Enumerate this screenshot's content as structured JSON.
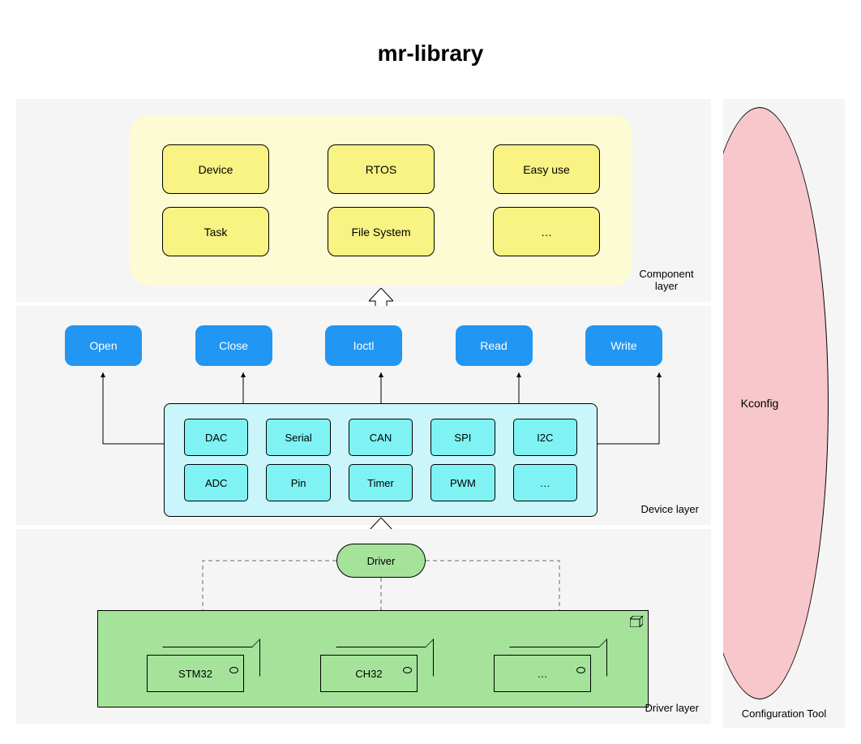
{
  "title": "mr-library",
  "layers": {
    "component": {
      "label": "Component layer",
      "items": [
        "Device",
        "RTOS",
        "Easy use",
        "Task",
        "File System",
        "…"
      ]
    },
    "device": {
      "label": "Device layer",
      "api": [
        "Open",
        "Close",
        "Ioctl",
        "Read",
        "Write"
      ],
      "items": [
        "DAC",
        "Serial",
        "CAN",
        "SPI",
        "I2C",
        "ADC",
        "Pin",
        "Timer",
        "PWM",
        "…"
      ]
    },
    "driver": {
      "label": "Driver layer",
      "pill": "Driver",
      "chips": [
        "STM32",
        "CH32",
        "…"
      ]
    }
  },
  "config": {
    "name": "Kconfig",
    "label": "Configuration Tool"
  },
  "colors": {
    "yellow_bg": "#fdfbd4",
    "yellow_item": "#f8f383",
    "blue_api": "#2196f3",
    "cyan_bg": "#caf6fb",
    "cyan_item": "#7ff3f3",
    "green": "#a5e39b",
    "pink": "#f7c7cb",
    "gray": "#f5f5f5"
  }
}
